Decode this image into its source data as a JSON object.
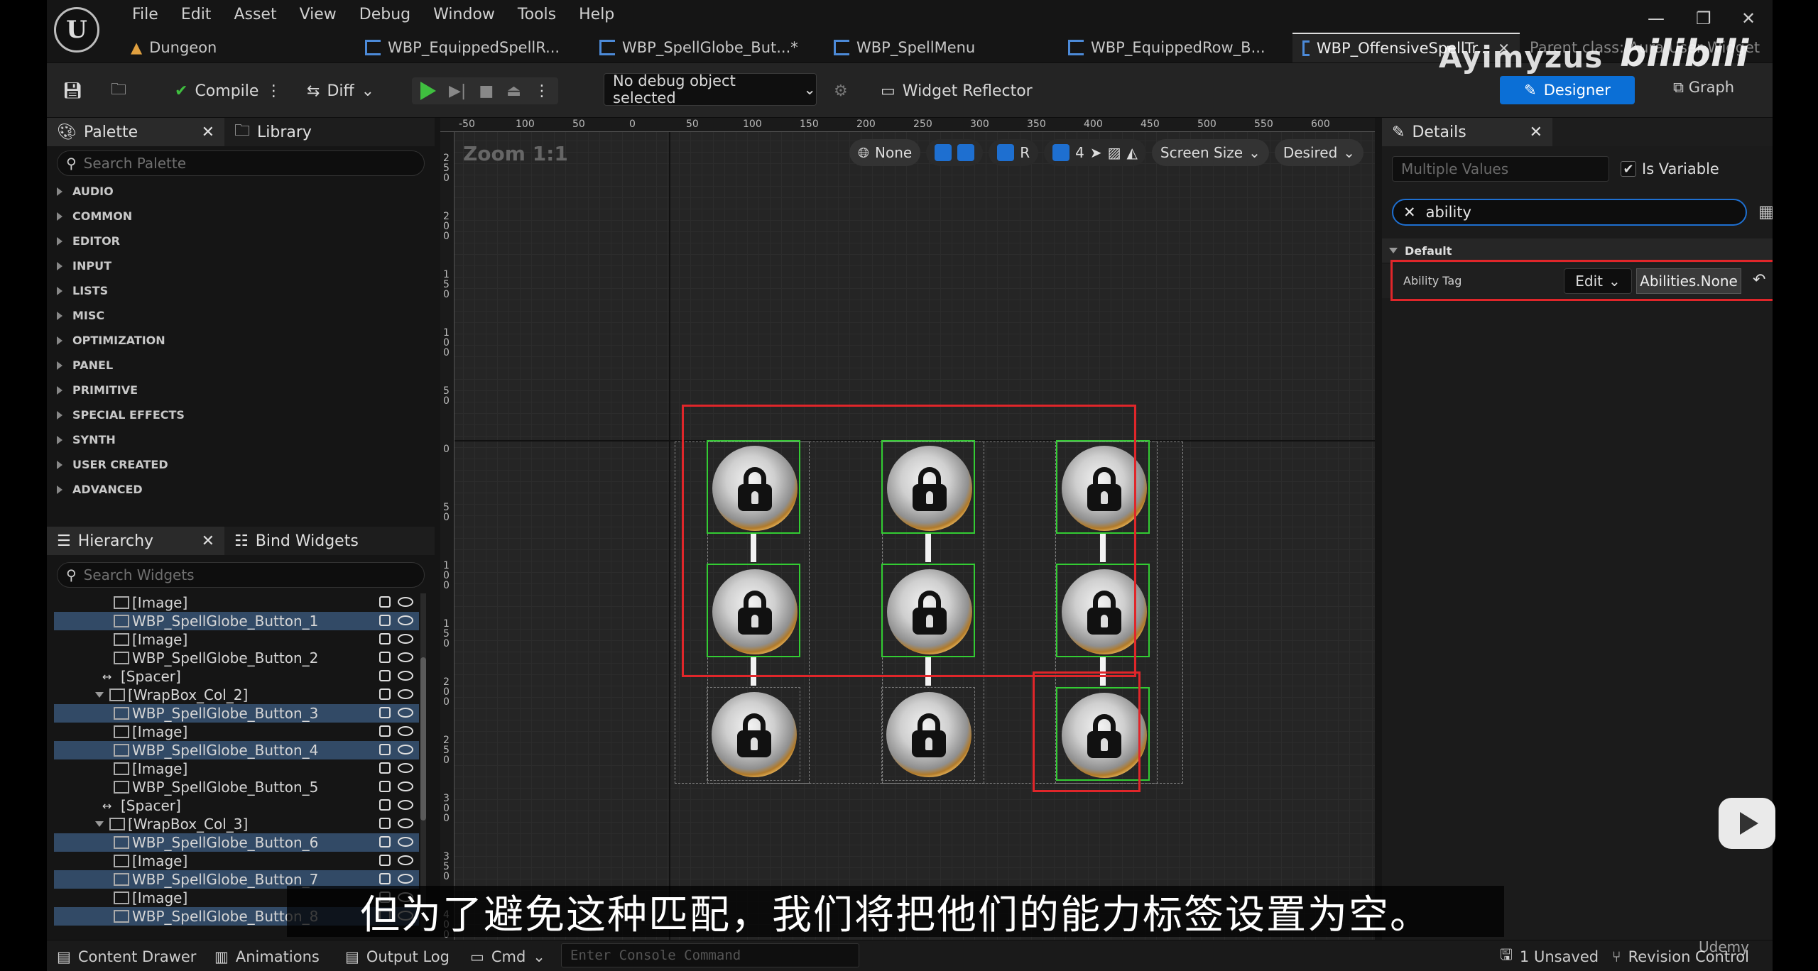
{
  "menu": [
    "File",
    "Edit",
    "Asset",
    "View",
    "Debug",
    "Window",
    "Tools",
    "Help"
  ],
  "tabs": [
    {
      "label": "Dungeon"
    },
    {
      "label": "WBP_EquippedSpellR..."
    },
    {
      "label": "WBP_SpellGlobe_But...*"
    },
    {
      "label": "WBP_SpellMenu"
    },
    {
      "label": "WBP_EquippedRow_B..."
    },
    {
      "label": "WBP_OffensiveSpellTr..."
    }
  ],
  "parent_class": "Parent class: Aura User Widget",
  "toolbar": {
    "compile": "Compile",
    "diff": "Diff",
    "debug_object": "No debug object selected",
    "widget_reflector": "Widget Reflector",
    "designer": "Designer",
    "graph": "Graph"
  },
  "watermark": {
    "author": "Ayimyzus",
    "site": "bilibili"
  },
  "palette": {
    "tab": "Palette",
    "library_tab": "Library",
    "search_placeholder": "Search Palette",
    "categories": [
      "AUDIO",
      "COMMON",
      "EDITOR",
      "INPUT",
      "LISTS",
      "MISC",
      "OPTIMIZATION",
      "PANEL",
      "PRIMITIVE",
      "SPECIAL EFFECTS",
      "SYNTH",
      "USER CREATED",
      "ADVANCED"
    ]
  },
  "hierarchy": {
    "tab": "Hierarchy",
    "bind_tab": "Bind Widgets",
    "search_placeholder": "Search Widgets",
    "rows": [
      {
        "label": "[Image]",
        "selected": false,
        "icon": "image-icon"
      },
      {
        "label": "WBP_SpellGlobe_Button_1",
        "selected": true,
        "icon": "widget-icon"
      },
      {
        "label": "[Image]",
        "selected": false,
        "icon": "image-icon"
      },
      {
        "label": "WBP_SpellGlobe_Button_2",
        "selected": false,
        "icon": "widget-icon"
      },
      {
        "label": "[Spacer]",
        "selected": false,
        "icon": "spacer-icon"
      },
      {
        "label": "[WrapBox_Col_2]",
        "selected": false,
        "icon": "wrapbox-icon"
      },
      {
        "label": "WBP_SpellGlobe_Button_3",
        "selected": true,
        "icon": "widget-icon"
      },
      {
        "label": "[Image]",
        "selected": false,
        "icon": "image-icon"
      },
      {
        "label": "WBP_SpellGlobe_Button_4",
        "selected": true,
        "icon": "widget-icon"
      },
      {
        "label": "[Image]",
        "selected": false,
        "icon": "image-icon"
      },
      {
        "label": "WBP_SpellGlobe_Button_5",
        "selected": false,
        "icon": "widget-icon"
      },
      {
        "label": "[Spacer]",
        "selected": false,
        "icon": "spacer-icon"
      },
      {
        "label": "[WrapBox_Col_3]",
        "selected": false,
        "icon": "wrapbox-icon"
      },
      {
        "label": "WBP_SpellGlobe_Button_6",
        "selected": true,
        "icon": "widget-icon"
      },
      {
        "label": "[Image]",
        "selected": false,
        "icon": "image-icon"
      },
      {
        "label": "WBP_SpellGlobe_Button_7",
        "selected": true,
        "icon": "widget-icon"
      },
      {
        "label": "[Image]",
        "selected": false,
        "icon": "image-icon"
      },
      {
        "label": "WBP_SpellGlobe_Button_8",
        "selected": true,
        "icon": "widget-icon"
      }
    ]
  },
  "canvas": {
    "zoom": "Zoom 1:1",
    "none_label": "None",
    "r_label": "R",
    "grid_value": "4",
    "screen_size": "Screen Size",
    "desired": "Desired",
    "ruler_top": [
      "-50",
      "100",
      "50",
      "0",
      "50",
      "100",
      "150",
      "200",
      "250",
      "300",
      "350",
      "400",
      "450",
      "500",
      "550",
      "600"
    ],
    "ruler_left": [
      "250",
      "200",
      "150",
      "100",
      "50",
      "0",
      "50",
      "100",
      "150",
      "200",
      "250",
      "300",
      "350",
      "400"
    ]
  },
  "details": {
    "tab": "Details",
    "name_field": "Multiple Values",
    "is_variable": "Is Variable",
    "filter": "ability",
    "section": "Default",
    "property_name": "Ability Tag",
    "edit_label": "Edit",
    "tag_value": "Abilities.None"
  },
  "bottom": {
    "content_drawer": "Content Drawer",
    "animations": "Animations",
    "output_log": "Output Log",
    "cmd": "Cmd",
    "console_placeholder": "Enter Console Command",
    "unsaved": "1 Unsaved",
    "revision": "Revision Control",
    "udemy": "Udemy"
  },
  "subtitle": "但为了避免这种匹配，我们将把他们的能力标签设置为空。",
  "colors": {
    "highlight_red": "#e0262a",
    "select_green": "#33cc33",
    "accent_blue": "#0b6fd6",
    "selection_row": "#324a66"
  }
}
